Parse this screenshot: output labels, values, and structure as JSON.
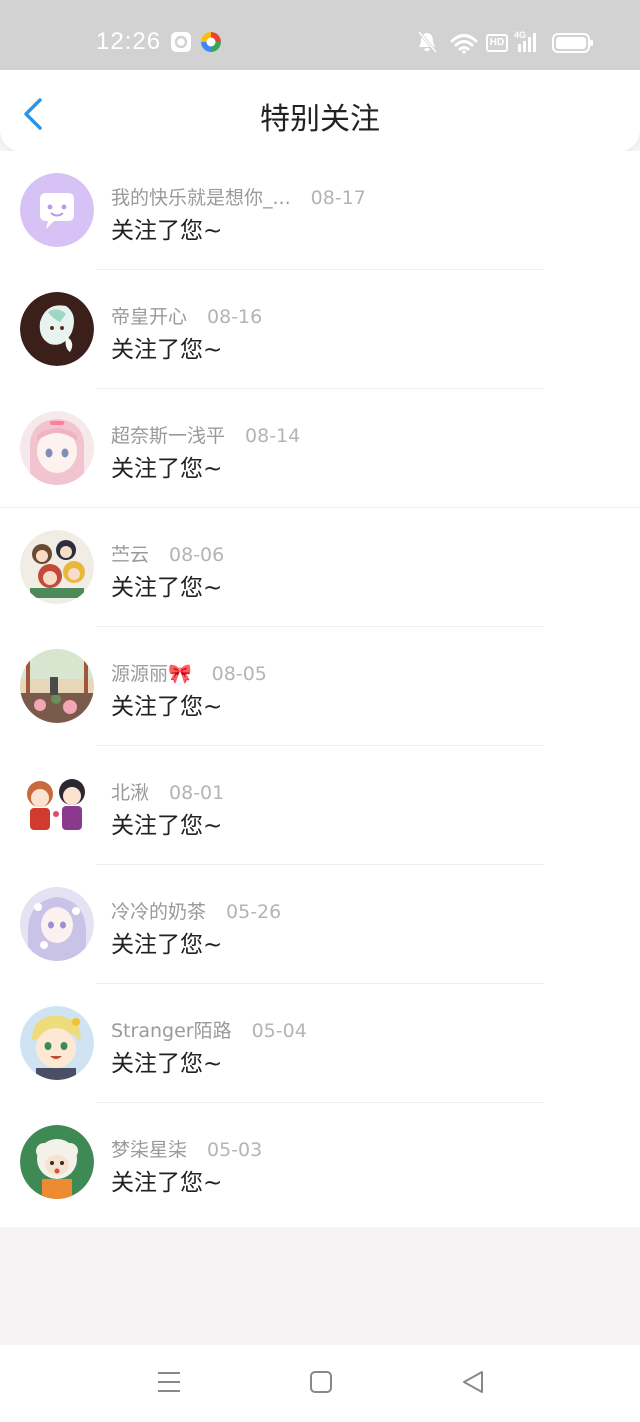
{
  "status_bar": {
    "time": "12:26",
    "icons": [
      "app-notification-icon",
      "browser-icon",
      "mute-icon",
      "wifi-icon",
      "hd-icon",
      "4g-signal-icon",
      "battery-icon"
    ],
    "hd_label": "HD",
    "network_label": "4G"
  },
  "header": {
    "title": "特别关注",
    "back_icon": "chevron-left-icon",
    "accent_color": "#2a93e8"
  },
  "items": [
    {
      "name": "我的快乐就是想你_...",
      "date": "08-17",
      "message": "关注了您~"
    },
    {
      "name": "帝皇开心",
      "date": "08-16",
      "message": "关注了您~"
    },
    {
      "name": "超奈斯一浅平",
      "date": "08-14",
      "message": "关注了您~"
    },
    {
      "name": "苎云",
      "date": "08-06",
      "message": "关注了您~"
    },
    {
      "name": "源源丽🎀",
      "date": "08-05",
      "message": "关注了您~"
    },
    {
      "name": "北湫",
      "date": "08-01",
      "message": "关注了您~"
    },
    {
      "name": "冷冷的奶茶",
      "date": "05-26",
      "message": "关注了您~"
    },
    {
      "name": "Stranger陌路",
      "date": "05-04",
      "message": "关注了您~"
    },
    {
      "name": "梦柒星柒",
      "date": "05-03",
      "message": "关注了您~"
    }
  ],
  "system_nav": {
    "icons": [
      "menu-icon",
      "home-square-icon",
      "back-triangle-icon"
    ]
  }
}
